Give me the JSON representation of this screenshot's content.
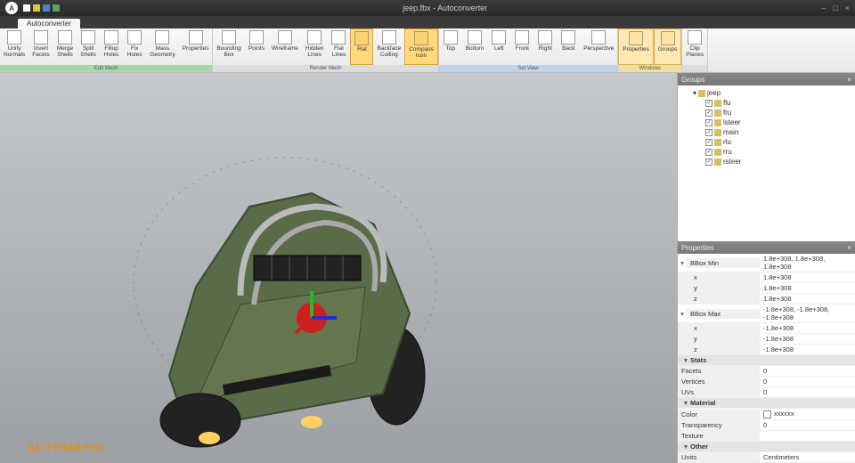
{
  "titlebar": {
    "title": "jeep.fbx - Autoconverter",
    "logo": "A",
    "minimize": "–",
    "maximize": "□",
    "close": "×"
  },
  "tabs": {
    "active": "Autoconverter"
  },
  "ribbon": {
    "group1": {
      "label": "Edit Mesh",
      "btns": [
        "Unify\nNormals",
        "Invert\nFacets",
        "Merge\nShells",
        "Split\nShells",
        "Fillup\nHoles",
        "Fix\nHoles",
        "Mass\nGeometry",
        "Properties"
      ]
    },
    "group2": {
      "label": "Render Mesh",
      "btns": [
        "Bounding\nBox",
        "Points",
        "Wireframe",
        "Hidden\nLines",
        "Flat\nLines",
        "Flat",
        "Backface\nCulling",
        "Compass\nIcon"
      ]
    },
    "group3": {
      "label": "Set View",
      "btns": [
        "Top",
        "Bottom",
        "Left",
        "Front",
        "Right",
        "Back",
        "Perspective"
      ]
    },
    "group4": {
      "label": "Windows",
      "btns": [
        "Properties",
        "Groups"
      ]
    },
    "group5": {
      "label": "",
      "btns": [
        "Clip\nPlanes"
      ]
    }
  },
  "groups_panel": {
    "title": "Groups",
    "root": "jeep",
    "items": [
      "flu",
      "fru",
      "lsteer",
      "main",
      "rlu",
      "rru",
      "rsteer"
    ]
  },
  "props_panel": {
    "title": "Properties",
    "bbox_min": {
      "label": "BBox Min",
      "val": "1.8e+308, 1.8e+308, 1.8e+308",
      "x": "1.8e+308",
      "y": "1.8e+308",
      "z": "1.8e+308"
    },
    "bbox_max": {
      "label": "BBox Max",
      "val": "-1.8e+308, -1.8e+308, -1.8e+308",
      "x": "-1.8e+308",
      "y": "-1.8e+308",
      "z": "-1.8e+308"
    },
    "stats": {
      "label": "Stats",
      "facets_k": "Facets",
      "facets_v": "0",
      "vertices_k": "Vertices",
      "vertices_v": "0",
      "uvs_k": "UVs",
      "uvs_v": "0"
    },
    "material": {
      "label": "Material",
      "color_k": "Color",
      "color_v": "xxxxxx",
      "trans_k": "Transparency",
      "trans_v": "0",
      "tex_k": "Texture",
      "tex_v": ""
    },
    "other": {
      "label": "Other",
      "units_k": "Units",
      "units_v": "Centimeters"
    }
  },
  "watermark": "AUTOMAPKI"
}
